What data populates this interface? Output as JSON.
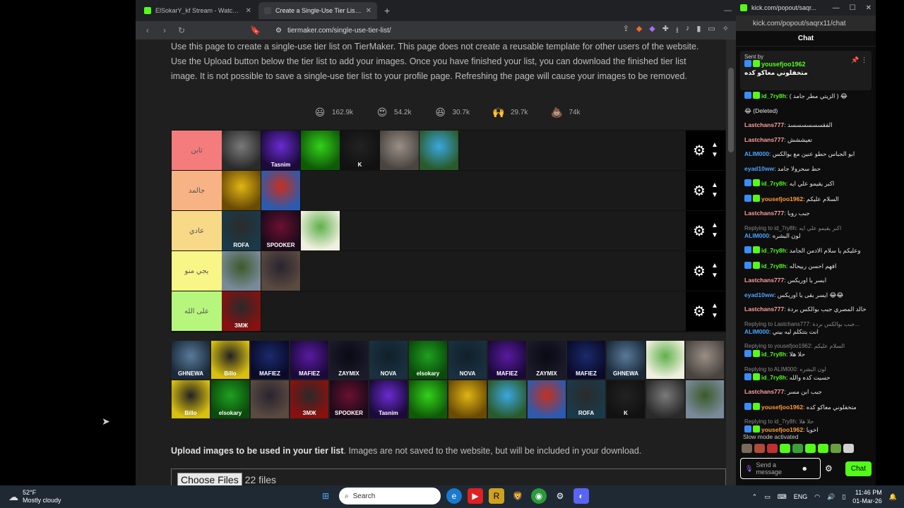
{
  "browser": {
    "tabs": [
      {
        "title": "ElSokarY_kf Stream - Watch Live on Kick",
        "favicon_color": "#53fc18",
        "active": false
      },
      {
        "title": "Create a Single-Use Tier List (Pri",
        "favicon_color": "#2b2b2b",
        "active": true
      }
    ],
    "url": "tiermaker.com/single-use-tier-list/"
  },
  "page": {
    "intro": "Use this page to create a single-use tier list on TierMaker. This page does not create a reusable template for other users of the website. Use the Upload button below the tier list to add your images. Once you have finished your list, you can download the finished tier list image. It is not possible to save a single-use tier list to your profile page. Refreshing the page will cause your images to be removed.",
    "reactions": [
      {
        "icon": "grinning-face",
        "glyph": "😃",
        "count": "162.9k"
      },
      {
        "icon": "heart-eyes",
        "glyph": "😍",
        "count": "54.2k"
      },
      {
        "icon": "laughing-face",
        "glyph": "😆",
        "count": "30.7k"
      },
      {
        "icon": "raised-hands",
        "glyph": "🙌",
        "count": "29.7k"
      },
      {
        "icon": "poop",
        "glyph": "💩",
        "count": "74k"
      }
    ],
    "tiers": [
      {
        "label": "ثابن",
        "color": "#f47c7c",
        "items": [
          {
            "c1": "#7a7a7a",
            "c2": "#2a2a2a",
            "label": ""
          },
          {
            "c1": "#6a2bd1",
            "c2": "#1b0a3a",
            "label": "Tasnim"
          },
          {
            "c1": "#33d11b",
            "c2": "#0f5a07",
            "label": ""
          },
          {
            "c1": "#222222",
            "c2": "#111111",
            "label": "K"
          },
          {
            "c1": "#9a8f86",
            "c2": "#4a4440",
            "label": ""
          },
          {
            "c1": "#3aa7e0",
            "c2": "#2a5a2a",
            "label": ""
          }
        ]
      },
      {
        "label": "جالمد",
        "color": "#f7b383",
        "items": [
          {
            "c1": "#e0b514",
            "c2": "#6a4a05",
            "label": ""
          },
          {
            "c1": "#c5301f",
            "c2": "#2a5bb0",
            "label": ""
          }
        ]
      },
      {
        "label": "عادي",
        "color": "#f8d987",
        "items": [
          {
            "c1": "#2b2b2b",
            "c2": "#1a3a4a",
            "label": "ROFA"
          },
          {
            "c1": "#6a1030",
            "c2": "#1a0a1a",
            "label": "SPOOKER"
          },
          {
            "c1": "#5fb04a",
            "c2": "#f0f0e0",
            "label": ""
          }
        ]
      },
      {
        "label": "يجي منو",
        "color": "#f8f686",
        "items": [
          {
            "c1": "#3b5a2b",
            "c2": "#7a8a9a",
            "label": ""
          },
          {
            "c1": "#2a2430",
            "c2": "#5a4a40",
            "label": ""
          }
        ]
      },
      {
        "label": "على الله",
        "color": "#b7f67d",
        "items": [
          {
            "c1": "#2a2a2a",
            "c2": "#8a1010",
            "label": "ЗМЖ"
          }
        ]
      }
    ],
    "pool": [
      {
        "c1": "#5a7a9a",
        "c2": "#1a2a3a",
        "label": "GHNEWA"
      },
      {
        "c1": "#222222",
        "c2": "#d8c010",
        "label": "Billo"
      },
      {
        "c1": "#1a2a6a",
        "c2": "#0a0a2a",
        "label": "MAFIEZ"
      },
      {
        "c1": "#5a1aa0",
        "c2": "#1a0a3a",
        "label": "MAFIEZ"
      },
      {
        "c1": "#0a0a14",
        "c2": "#1a1a2a",
        "label": "ZAYMIX"
      },
      {
        "c1": "#10202a",
        "c2": "#1a3040",
        "label": "NOVA"
      },
      {
        "c1": "#1fa020",
        "c2": "#0a4a0a",
        "label": "elsokary"
      },
      {
        "c1": "#10202a",
        "c2": "#1a3040",
        "label": "NOVA"
      },
      {
        "c1": "#5a1aa0",
        "c2": "#1a0a3a",
        "label": "MAFIEZ"
      },
      {
        "c1": "#0a0a14",
        "c2": "#1a1a2a",
        "label": "ZAYMIX"
      },
      {
        "c1": "#1a2a6a",
        "c2": "#0a0a2a",
        "label": "MAFIEZ"
      },
      {
        "c1": "#5a7a9a",
        "c2": "#1a2a3a",
        "label": "GHNEWA"
      },
      {
        "c1": "#5fb04a",
        "c2": "#f0f0e0",
        "label": ""
      },
      {
        "c1": "#9a8f86",
        "c2": "#4a4440",
        "label": ""
      },
      {
        "c1": "#222222",
        "c2": "#d8c010",
        "label": "Billo"
      },
      {
        "c1": "#1fa020",
        "c2": "#0a4a0a",
        "label": "elsokary"
      },
      {
        "c1": "#2a2430",
        "c2": "#5a4a40",
        "label": ""
      },
      {
        "c1": "#2a2a2a",
        "c2": "#8a1010",
        "label": "ЗМЖ"
      },
      {
        "c1": "#6a1030",
        "c2": "#1a0a1a",
        "label": "SPOOKER"
      },
      {
        "c1": "#6a2bd1",
        "c2": "#1b0a3a",
        "label": "Tasnim"
      },
      {
        "c1": "#33d11b",
        "c2": "#0f5a07",
        "label": ""
      },
      {
        "c1": "#e0b514",
        "c2": "#6a4a05",
        "label": ""
      },
      {
        "c1": "#3aa7e0",
        "c2": "#2a5a2a",
        "label": ""
      },
      {
        "c1": "#c5301f",
        "c2": "#2a5bb0",
        "label": ""
      },
      {
        "c1": "#2b2b2b",
        "c2": "#1a3a4a",
        "label": "ROFA"
      },
      {
        "c1": "#222222",
        "c2": "#111111",
        "label": "K"
      },
      {
        "c1": "#7a7a7a",
        "c2": "#2a2a2a",
        "label": ""
      },
      {
        "c1": "#3b5a2b",
        "c2": "#7a8a9a",
        "label": ""
      }
    ],
    "upload_bold": "Upload images to be used in your tier list",
    "upload_rest": ". Images are not saved to the website, but will be included in your download.",
    "choose_files": "Choose Files",
    "files_count": "22 files"
  },
  "chat": {
    "window_title": "kick.com/popout/saqr...",
    "url": "kick.com/popout/saqrx11/chat",
    "title": "Chat",
    "pinned": {
      "sent_by": "Sent by",
      "user": "yousefjoo1962",
      "message": "متخفلوني معاكو كده"
    },
    "messages": [
      {
        "reply": "",
        "user": "id_7ry8h",
        "color": "#53fc18",
        "badges": true,
        "text": "( الزيتي مطر جامد ) 😂"
      },
      {
        "reply": "",
        "user": "",
        "color": "#fff",
        "badges": false,
        "text": "😂 (Deleted)"
      },
      {
        "reply": "",
        "user": "Lastchans777",
        "color": "#ff9d9d",
        "badges": false,
        "text": "الفقسسسسسسد"
      },
      {
        "reply": "",
        "user": "Lastchans777",
        "color": "#ff9d9d",
        "badges": false,
        "text": "تعيششش"
      },
      {
        "reply": "",
        "user": "ALIM000",
        "color": "#4aa3ff",
        "badges": false,
        "text": "ابو الجباس حطو عنين مع بوالكس"
      },
      {
        "reply": "",
        "user": "eyad10ww",
        "color": "#4aa3ff",
        "badges": false,
        "text": "حط سحرولا جامد"
      },
      {
        "reply": "",
        "user": "id_7ry8h",
        "color": "#53fc18",
        "badges": true,
        "text": "اكبر يقيمو علي ايه"
      },
      {
        "reply": "",
        "user": "yousefjoo1962",
        "color": "#ff9d3a",
        "badges": true,
        "text": "السلام عليكم"
      },
      {
        "reply": "",
        "user": "Lastchans777",
        "color": "#ff9d9d",
        "badges": false,
        "text": "جبب روبا"
      },
      {
        "reply": "Replying to id_7ry8h: اكبر يقيمو علي ايه",
        "user": "ALIM000",
        "color": "#4aa3ff",
        "badges": false,
        "text": "لون البشره"
      },
      {
        "reply": "",
        "user": "id_7ry8h",
        "color": "#53fc18",
        "badges": true,
        "text": "وعليكم يا سلام الادمن الجامد"
      },
      {
        "reply": "",
        "user": "id_7ry8h",
        "color": "#53fc18",
        "badges": true,
        "text": "افهم احسن ربيحاله"
      },
      {
        "reply": "",
        "user": "Lastchans777",
        "color": "#ff9d9d",
        "badges": false,
        "text": "ابسر يا اوريكس"
      },
      {
        "reply": "",
        "user": "eyad10ww",
        "color": "#4aa3ff",
        "badges": false,
        "text": "ايسر بقى يا اوريكس 😂😂"
      },
      {
        "reply": "",
        "user": "Lastchans777",
        "color": "#ff9d9d",
        "badges": false,
        "text": "خالد المصري جبب بوالكس بردة"
      },
      {
        "reply": "Replying to Lastchans777: جبب بوالكس بردة...",
        "user": "ALIM000",
        "color": "#4aa3ff",
        "badges": false,
        "text": "انت بتتكلم ليه بيني"
      },
      {
        "reply": "Replying to yousefjoo1962: السلام عليكم",
        "user": "id_7ry8h",
        "color": "#53fc18",
        "badges": true,
        "text": "حلا هلا"
      },
      {
        "reply": "Replying to ALIM000: لون البشره",
        "user": "id_7ry8h",
        "color": "#53fc18",
        "badges": true,
        "text": "حسيت كده والله"
      },
      {
        "reply": "",
        "user": "Lastchans777",
        "color": "#ff9d9d",
        "badges": false,
        "text": "جبب ابن مسر"
      },
      {
        "reply": "",
        "user": "yousefjoo1962",
        "color": "#ff9d3a",
        "badges": true,
        "text": "متخفلوني معاكو كده"
      },
      {
        "reply": "Replying to id_7ry8h: حلا هلا",
        "user": "yousefjoo1962",
        "color": "#ff9d3a",
        "badges": true,
        "text": "اخويا"
      }
    ],
    "slow_mode": "Slow mode activated",
    "send_placeholder": "Send a message",
    "send_button": "Chat"
  },
  "taskbar": {
    "temp": "52°F",
    "weather": "Mostly cloudy",
    "search": "Search",
    "lang": "ENG",
    "time": "11:46 PM",
    "date": "01-Mar-26"
  }
}
